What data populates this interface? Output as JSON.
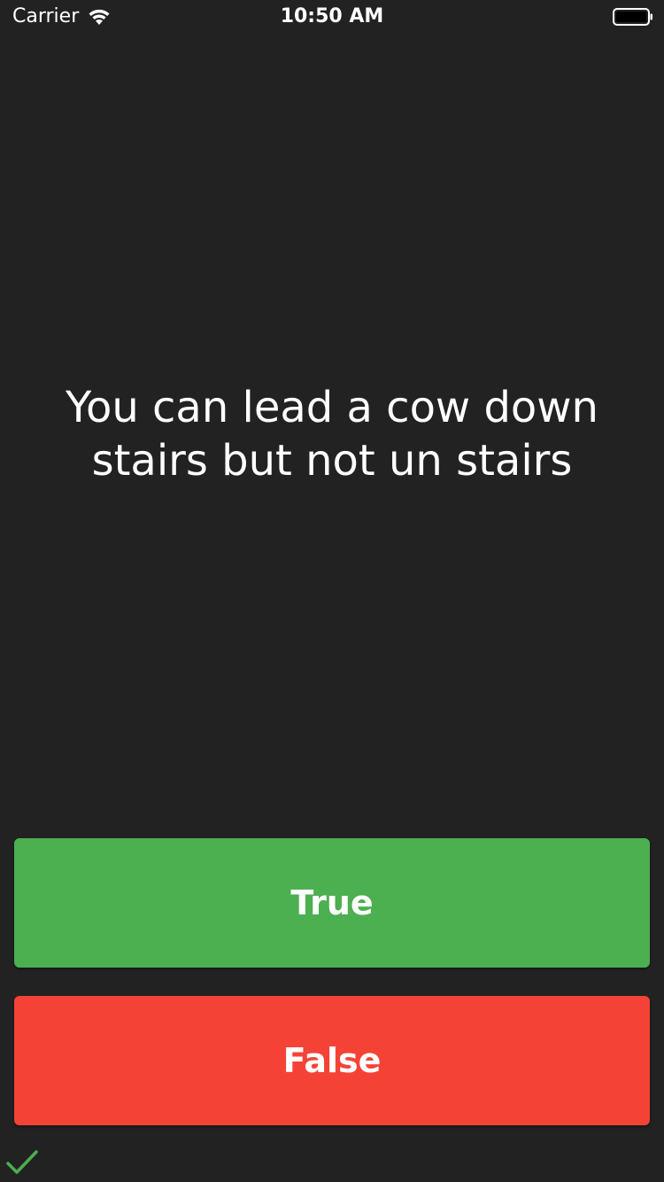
{
  "status_bar": {
    "carrier": "Carrier",
    "time": "10:50 AM",
    "wifi_icon": "wifi-icon",
    "battery_icon": "battery-icon"
  },
  "question": {
    "text": "You can lead a cow down stairs but not un stairs"
  },
  "buttons": {
    "true_label": "True",
    "false_label": "False"
  },
  "score": {
    "icons": [
      "check-icon"
    ]
  },
  "colors": {
    "background": "#222222",
    "true_button": "#4caf50",
    "false_button": "#f44336",
    "check": "#4caf50",
    "text": "#ffffff"
  }
}
